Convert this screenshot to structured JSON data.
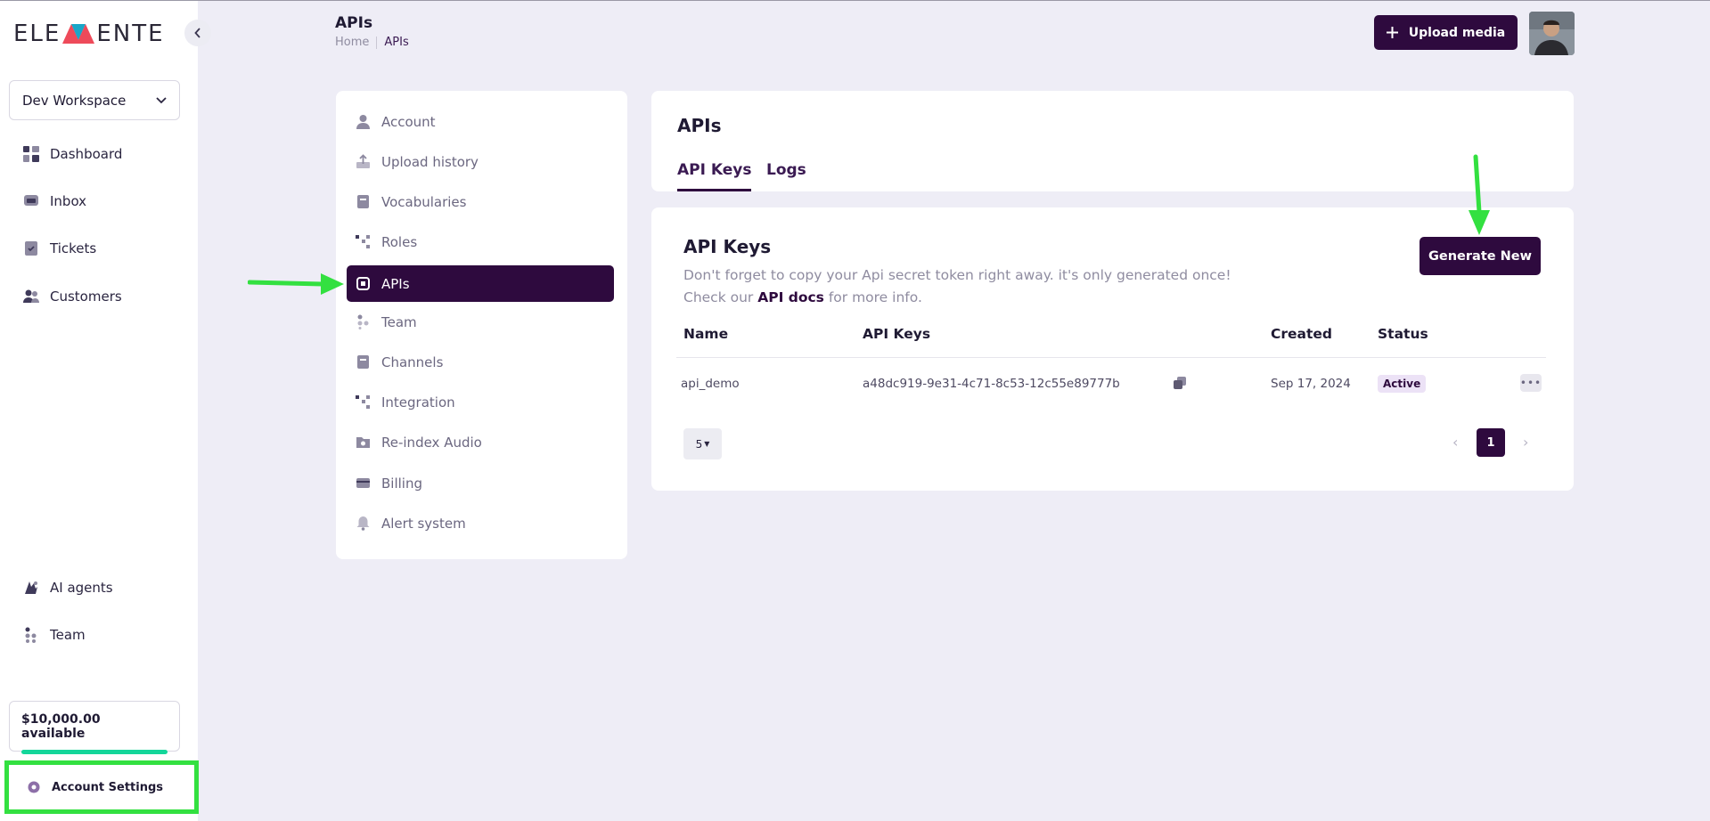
{
  "brand": {
    "left": "ELE",
    "right": "ENTE"
  },
  "sidebar": {
    "workspace": "Dev Workspace",
    "items": [
      {
        "label": "Dashboard",
        "icon": "dashboard-icon"
      },
      {
        "label": "Inbox",
        "icon": "inbox-icon"
      },
      {
        "label": "Tickets",
        "icon": "ticket-icon"
      },
      {
        "label": "Customers",
        "icon": "customers-icon"
      }
    ],
    "bottom_items": [
      {
        "label": "AI agents",
        "icon": "ai-agents-icon"
      },
      {
        "label": "Team",
        "icon": "team-icon"
      }
    ],
    "balance": {
      "text": "$10,000.00  available",
      "fill": 1.0
    },
    "account_settings": "Account Settings"
  },
  "header": {
    "title": "APIs",
    "breadcrumbs": [
      "Home",
      "APIs"
    ],
    "upload_label": "Upload media"
  },
  "settings_menu": [
    {
      "label": "Account",
      "icon": "user-icon"
    },
    {
      "label": "Upload history",
      "icon": "upload-icon"
    },
    {
      "label": "Vocabularies",
      "icon": "book-icon"
    },
    {
      "label": "Roles",
      "icon": "roles-icon"
    },
    {
      "label": "APIs",
      "icon": "api-icon",
      "active": true
    },
    {
      "label": "Team",
      "icon": "team-icon"
    },
    {
      "label": "Channels",
      "icon": "channels-icon"
    },
    {
      "label": "Integration",
      "icon": "integration-icon"
    },
    {
      "label": "Re-index Audio",
      "icon": "folder-icon"
    },
    {
      "label": "Billing",
      "icon": "billing-icon"
    },
    {
      "label": "Alert system",
      "icon": "bell-icon"
    }
  ],
  "apis_panel": {
    "title": "APIs",
    "tabs": [
      "API Keys",
      "Logs"
    ]
  },
  "keys": {
    "title": "API Keys",
    "desc_line1": "Don't forget to copy your Api secret token right away. it's only generated once!",
    "desc_prefix": "Check our ",
    "desc_link": "API docs",
    "desc_suffix": " for more info.",
    "generate_label": "Generate New",
    "columns": [
      "Name",
      "API Keys",
      "Created",
      "Status"
    ],
    "rows": [
      {
        "name": "api_demo",
        "key": "a48dc919-9e31-4c71-8c53-12c55e89777b",
        "created": "Sep 17, 2024",
        "status": "Active"
      }
    ],
    "page_size": "5",
    "current_page": "1"
  },
  "colors": {
    "accent": "#2e0a3e",
    "highlight": "#33e040",
    "success": "#14d69a"
  }
}
